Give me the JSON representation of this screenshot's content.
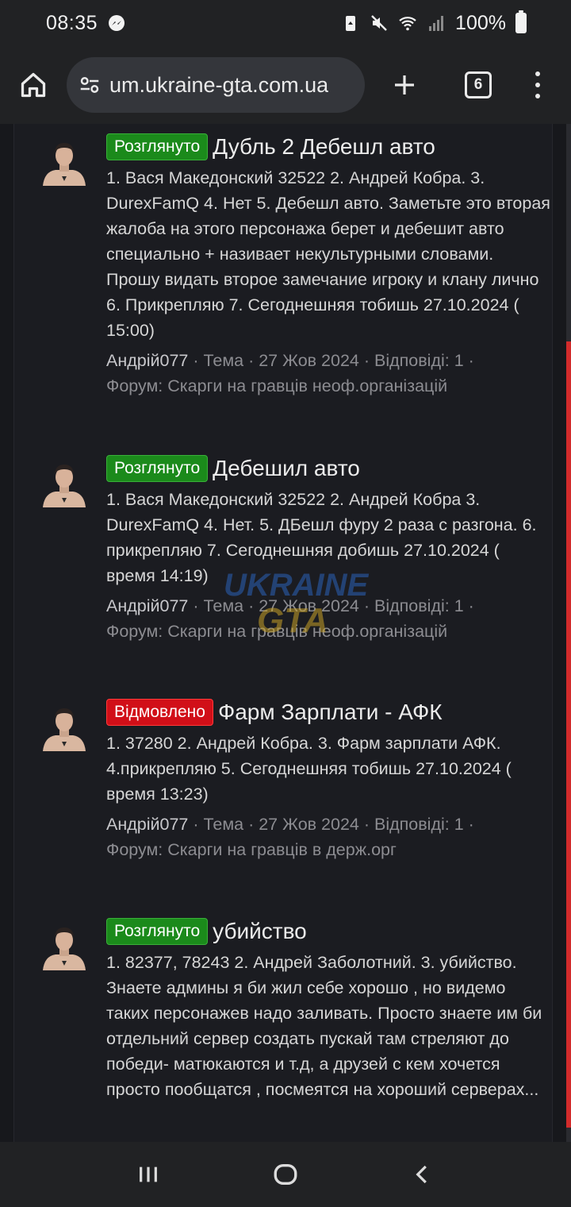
{
  "status_bar": {
    "time": "08:35",
    "battery": "100%",
    "icons": [
      "messenger-icon",
      "battery-saver-icon",
      "mute-icon",
      "wifi-icon",
      "signal-icon",
      "battery-icon"
    ]
  },
  "browser": {
    "url": "um.ukraine-gta.com.ua",
    "tab_count": "6"
  },
  "results": [
    {
      "badge": "Розглянуто",
      "badge_type": "approved",
      "title": "Дубль 2 Дебешл авто",
      "snippet": "1. Вася Македонский 32522 2. Андрей Кобра. 3. DurexFamQ 4. Нет 5. Дебешл авто. Заметьте это вторая жалоба на этого персонажа берет и дебешит авто специально + називает некультурными словами. Прошу видать второе замечание игроку и клану лично 6. Прикрепляю 7. Сегоднешняя тобишь 27.10.2024 ( 15:00)",
      "author": "Андрій077",
      "meta": " · Тема · 27 Жов 2024 · Відповіді: 1 ·",
      "forum": "Форум: Скарги на гравців неоф.організацій"
    },
    {
      "badge": "Розглянуто",
      "badge_type": "approved",
      "title": "Дебешил авто",
      "snippet": "1. Вася Македонский 32522 2. Андрей Кобра 3. DurexFamQ 4. Нет. 5. ДБешл фуру 2 раза с разгона. 6. прикрепляю 7. Сегоднешняя добишь 27.10.2024 ( время 14:19)",
      "author": "Андрій077",
      "meta": " · Тема · 27 Жов 2024 · Відповіді: 1 ·",
      "forum": "Форум: Скарги на гравців неоф.організацій"
    },
    {
      "badge": "Відмовлено",
      "badge_type": "rejected",
      "title": "Фарм Зарплати - АФК",
      "snippet": "1. 37280 2. Андрей Кобра. 3. Фарм зарплати АФК. 4.прикрепляю 5. Сегоднешняя тобишь 27.10.2024 ( время 13:23)",
      "author": "Андрій077",
      "meta": " · Тема · 27 Жов 2024 · Відповіді: 1 ·",
      "forum": "Форум: Скарги на гравців в держ.орг"
    },
    {
      "badge": "Розглянуто",
      "badge_type": "approved",
      "title": "убийство",
      "snippet": "1. 82377, 78243 2. Андрей Заболотний. 3. убийство. Знаете админы я би жил себе хорошо , но видемо таких персонажев надо заливать. Просто знаете им би отдельний сервер создать пускай там стреляют до победи- матюкаются и т.д, а друзей с кем хочется просто пообщатся , посмеятся на хороший серверах...",
      "author": "",
      "meta": "",
      "forum": ""
    }
  ],
  "watermark": {
    "line1": "UKRAINE",
    "line2": "GTA"
  },
  "colors": {
    "approved": "#1b8a1b",
    "rejected": "#d10f18",
    "scrollbar": "#d22b2b"
  }
}
